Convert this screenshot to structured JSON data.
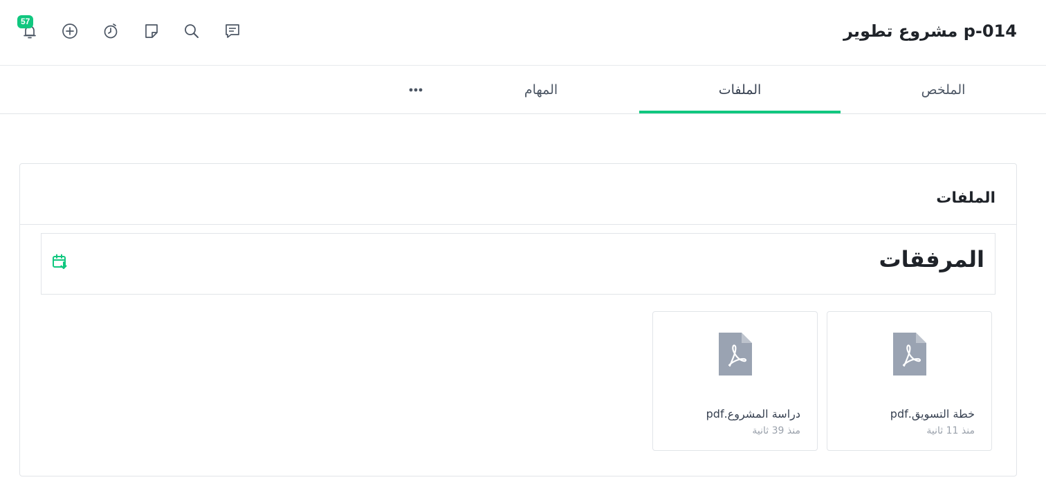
{
  "header": {
    "project_title": "p-014 مشروع تطوير",
    "notifications_count": "57",
    "icons": [
      "chat-icon",
      "search-icon",
      "note-icon",
      "timer-icon",
      "add-circle-icon",
      "bell-icon"
    ]
  },
  "tabs": [
    {
      "label": "الملخص",
      "active": false
    },
    {
      "label": "الملفات",
      "active": true
    },
    {
      "label": "المهام",
      "active": false
    }
  ],
  "card": {
    "title": "الملفات",
    "attachments_title": "المرفقات",
    "files": [
      {
        "name": "خطة التسويق.pdf",
        "time": "منذ 11 ثانية",
        "icon": "pdf-file-icon"
      },
      {
        "name": "دراسة المشروع.pdf",
        "time": "منذ 39 ثانية",
        "icon": "pdf-file-icon"
      }
    ]
  },
  "colors": {
    "accent": "#10c77f",
    "file_icon": "#9aa3b2",
    "border": "#e1e4e8"
  }
}
